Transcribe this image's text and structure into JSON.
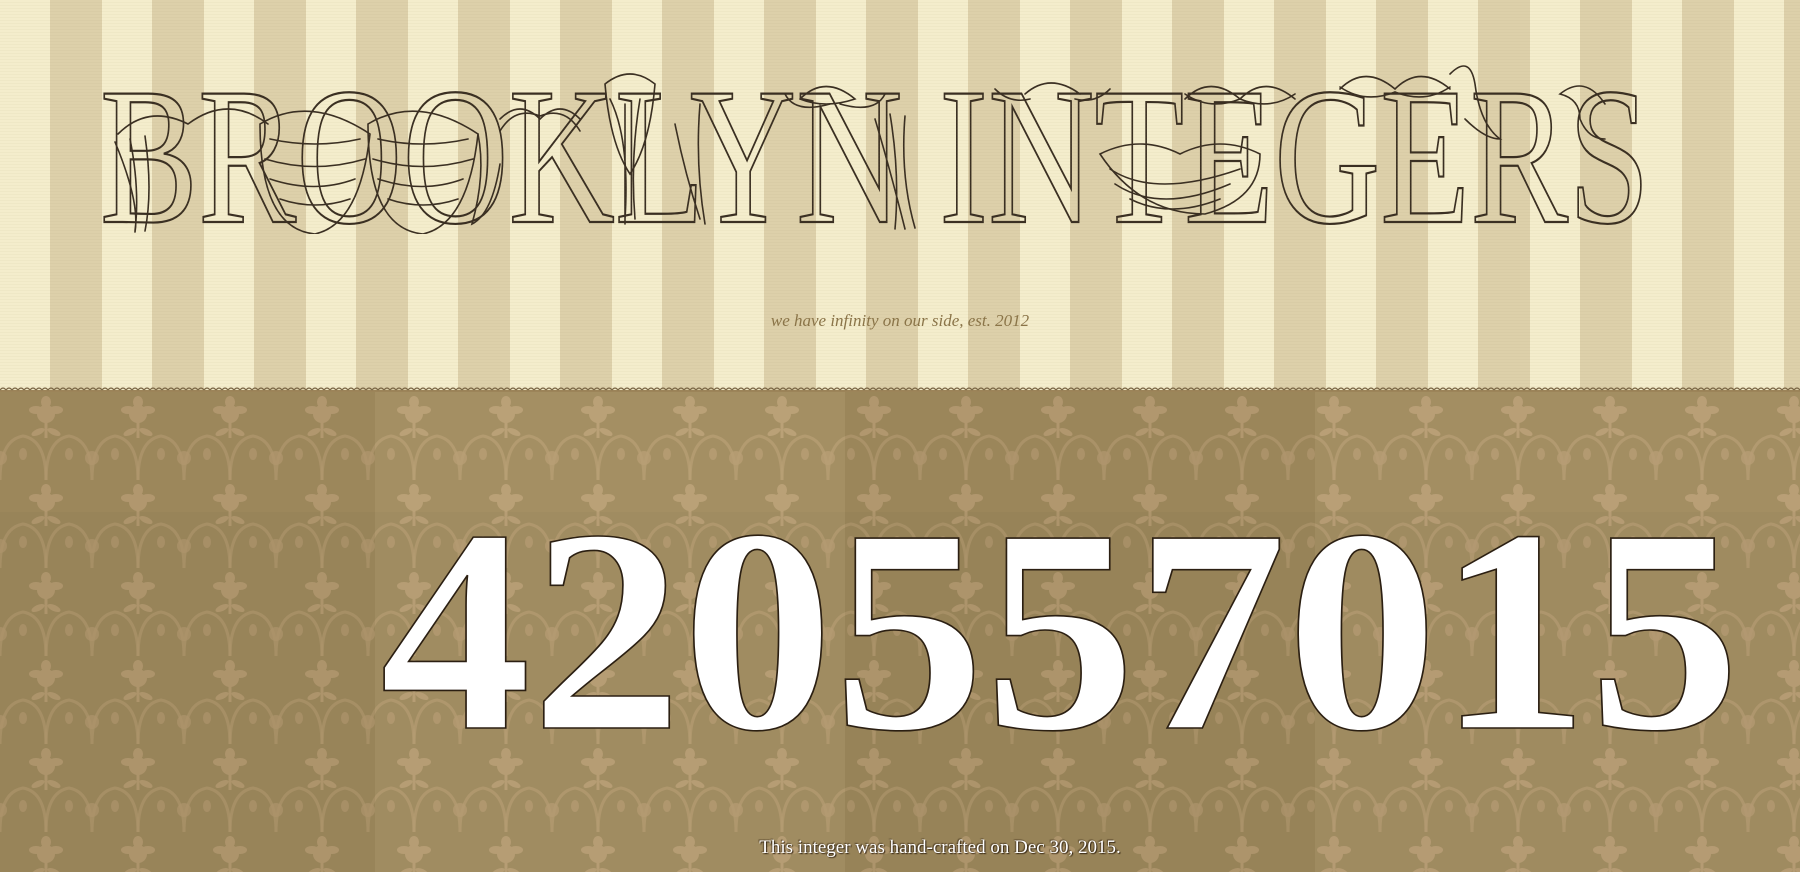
{
  "site": {
    "logo_text": "BROOKLYN INTEGERS",
    "tagline": "we have infinity on our side, est. 2012"
  },
  "integer": {
    "value": "42055701​5",
    "display": "420557015"
  },
  "footer": {
    "caption": "This integer was hand-crafted on Dec 30, 2015."
  },
  "colors": {
    "stripe_light": "#f4edcc",
    "stripe_dark": "#ddd0aa",
    "ink": "#3a2f22",
    "damask_bg": "#9f8a5e",
    "damask_motif": "#c1a67c",
    "number_fill": "#ffffff",
    "number_stroke": "#2b1f12"
  }
}
